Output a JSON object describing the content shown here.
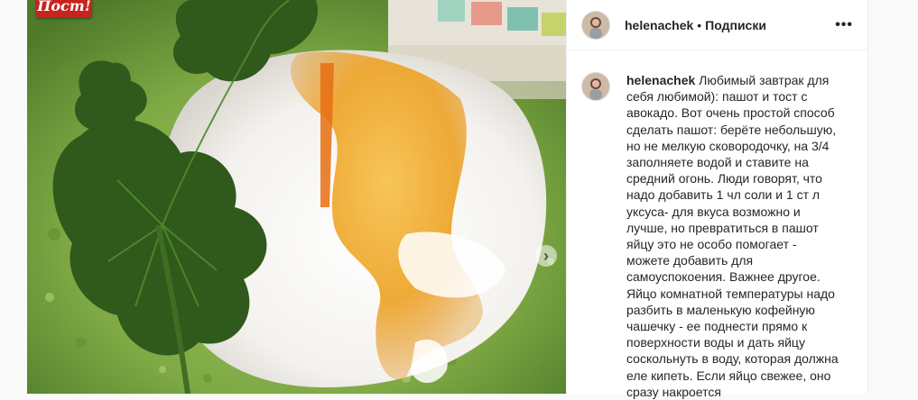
{
  "post": {
    "badge_text": "Пост!",
    "image_icon": "poached-egg-photo",
    "next_icon": "chevron-right-icon",
    "next_glyph": "›"
  },
  "header": {
    "username": "helenachek",
    "separator": "•",
    "follow_label": "Подписки",
    "more_glyph": "•••"
  },
  "caption": {
    "username": "helenachek",
    "text": "Любимый завтрак для себя любимой): пашот и тост с авокадо. Вот очень простой способ сделать пашот: берёте небольшую, но не мелкую сковородочку, на 3/4 заполняете водой и ставите на средний огонь. Люди говорят, что надо добавить 1 чл соли и 1 ст л уксуса- для вкуса возможно и лучше, но превратиться в пашот яйцу это не особо помогает - можете добавить для самоуспокоения. Важнее другое. Яйцо комнатной температуры надо разбить в маленькую кофейную чашечку - ее поднести прямо к поверхности воды и дать яйцу соскольнуть в воду, которая должна еле кипеть. Если яйцо свежее, оно сразу накроется"
  },
  "colors": {
    "badge": "#c8231d",
    "avocado": "#7fa843",
    "leaf": "#2f5a1c",
    "yolk": "#f0a41e"
  }
}
